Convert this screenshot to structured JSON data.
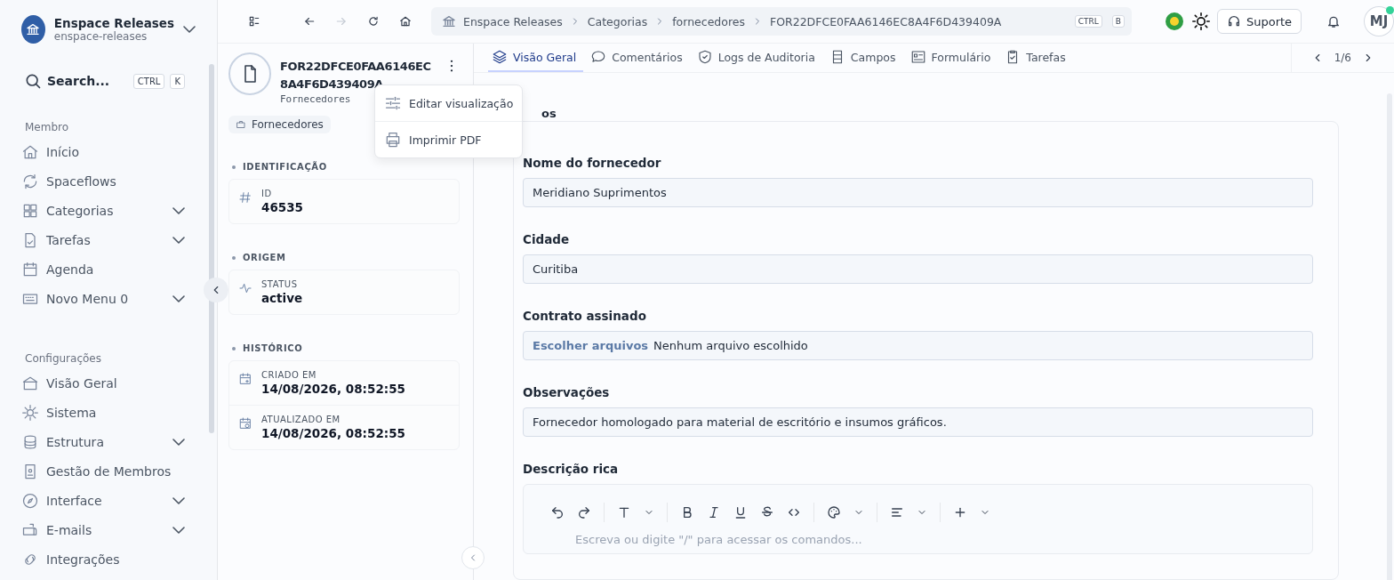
{
  "workspace": {
    "name": "Enspace Releases",
    "slug": "enspace-releases"
  },
  "search": {
    "placeholder": "Search...",
    "keys": [
      "CTRL",
      "K"
    ]
  },
  "sidebar": [
    {
      "heading": "Membro",
      "items": [
        {
          "label": "Início",
          "expandable": false
        },
        {
          "label": "Spaceflows",
          "expandable": false
        },
        {
          "label": "Categorias",
          "expandable": true
        },
        {
          "label": "Tarefas",
          "expandable": true
        },
        {
          "label": "Agenda",
          "expandable": false
        },
        {
          "label": "Novo Menu 0",
          "expandable": true
        }
      ]
    },
    {
      "heading": "Configurações",
      "items": [
        {
          "label": "Visão Geral",
          "expandable": false
        },
        {
          "label": "Sistema",
          "expandable": false
        },
        {
          "label": "Estrutura",
          "expandable": true
        },
        {
          "label": "Gestão de Membros",
          "expandable": false
        },
        {
          "label": "Interface",
          "expandable": true
        },
        {
          "label": "E-mails",
          "expandable": true
        },
        {
          "label": "Integrações",
          "expandable": false
        }
      ]
    }
  ],
  "breadcrumb": [
    "Enspace Releases",
    "Categorias",
    "fornecedores",
    "FOR22DFCE0FAA6146EC8A4F6D439409A"
  ],
  "breadcrumb_keys": [
    "CTRL",
    "B"
  ],
  "support_button": "Suporte",
  "avatar": {
    "initials": "MJ",
    "online": true
  },
  "record": {
    "title": "FOR22DFCE0FAA6146EC8A4F6D439409A",
    "subtitle": "Fornecedores",
    "tag": "Fornecedores",
    "menu": [
      "Editar visualização",
      "Imprimir PDF"
    ],
    "sections": [
      {
        "title": "IDENTIFICAÇÃO",
        "fields": [
          {
            "label": "ID",
            "value": "46535"
          }
        ]
      },
      {
        "title": "ORIGEM",
        "fields": [
          {
            "label": "STATUS",
            "value": "active"
          }
        ]
      },
      {
        "title": "HISTÓRICO",
        "fields": [
          {
            "label": "CRIADO EM",
            "value": "14/08/2026, 08:52:55"
          },
          {
            "label": "ATUALIZADO EM",
            "value": "14/08/2026, 08:52:55"
          }
        ]
      }
    ]
  },
  "tabs": [
    {
      "label": "Visão Geral",
      "selected": true
    },
    {
      "label": "Comentários",
      "selected": false
    },
    {
      "label": "Logs de Auditoria",
      "selected": false
    },
    {
      "label": "Campos",
      "selected": false
    },
    {
      "label": "Formulário",
      "selected": false
    },
    {
      "label": "Tarefas",
      "selected": false
    }
  ],
  "pager": "1/6",
  "form": {
    "section_title": "os",
    "fields": [
      {
        "kind": "text",
        "label": "Nome do fornecedor",
        "value": "Meridiano Suprimentos"
      },
      {
        "kind": "text",
        "label": "Cidade",
        "value": "Curitiba"
      },
      {
        "kind": "file",
        "label": "Contrato assinado",
        "button": "Escolher arquivos",
        "value": "Nenhum arquivo escolhido"
      },
      {
        "kind": "text",
        "label": "Observações",
        "value": "Fornecedor homologado para material de escritório e insumos gráficos."
      },
      {
        "kind": "rich",
        "label": "Descrição rica",
        "placeholder": "Escreva ou digite \"/\" para acessar os comandos..."
      }
    ]
  }
}
